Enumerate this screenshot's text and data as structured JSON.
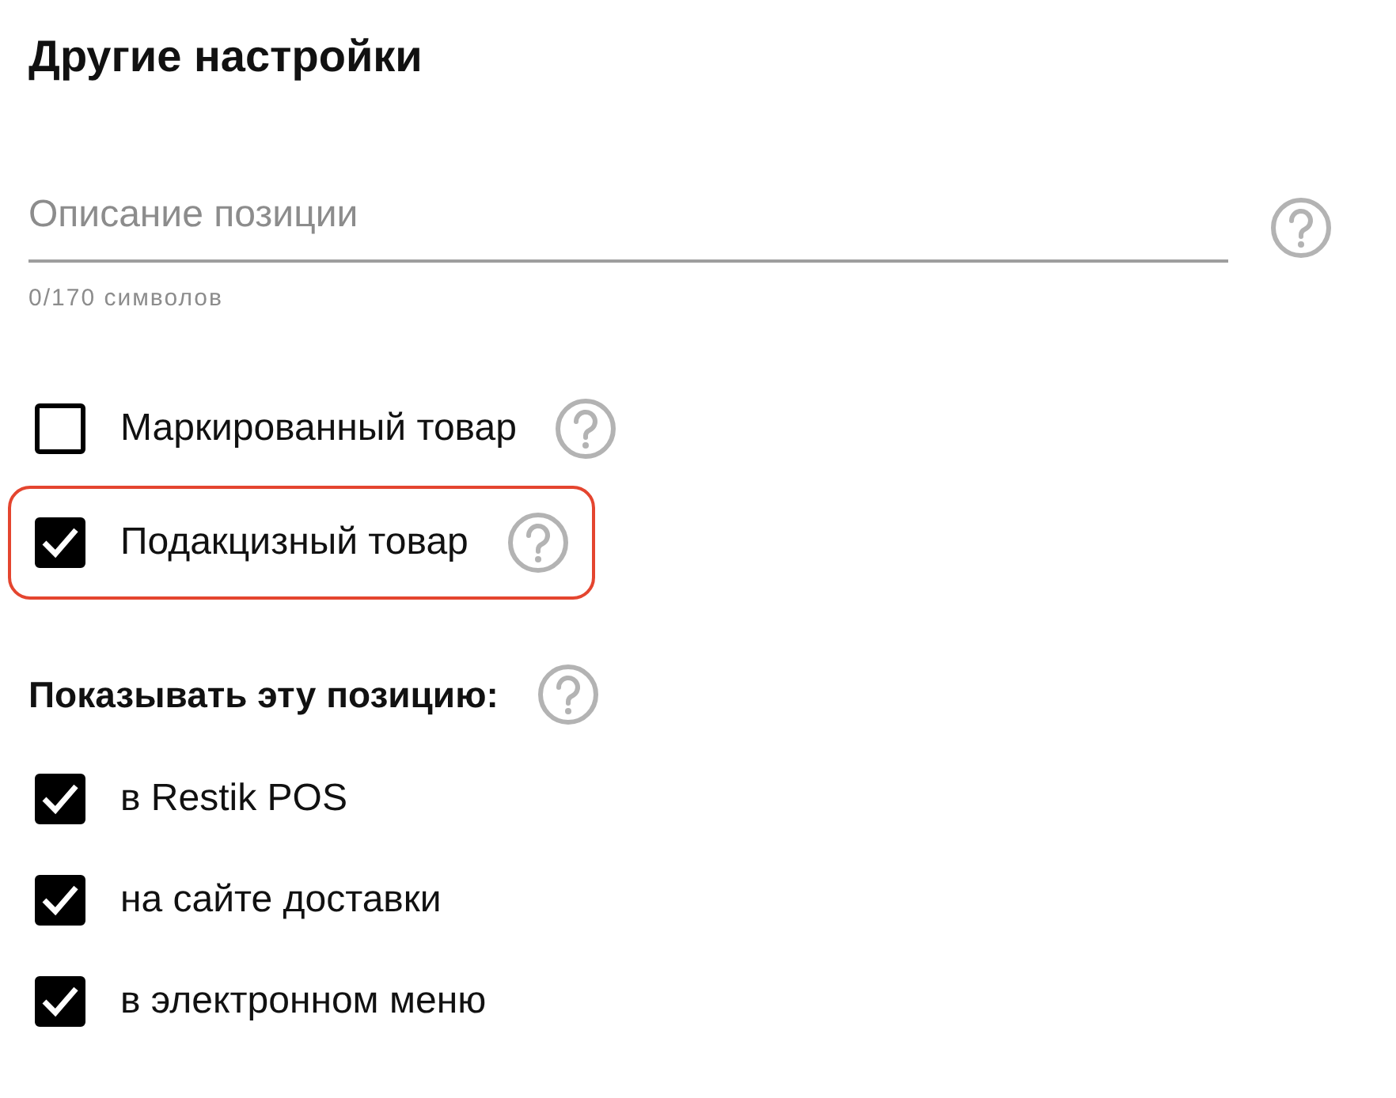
{
  "title": "Другие настройки",
  "description": {
    "placeholder": "Описание позиции",
    "counter": "0/170 символов"
  },
  "options": [
    {
      "label": "Маркированный товар",
      "checked": false,
      "highlighted": false
    },
    {
      "label": "Подакцизный товар",
      "checked": true,
      "highlighted": true
    }
  ],
  "visibility": {
    "heading": "Показывать эту позицию:",
    "options": [
      {
        "label": "в Restik POS",
        "checked": true
      },
      {
        "label": "на сайте доставки",
        "checked": true
      },
      {
        "label": "в электронном меню",
        "checked": true
      }
    ]
  }
}
